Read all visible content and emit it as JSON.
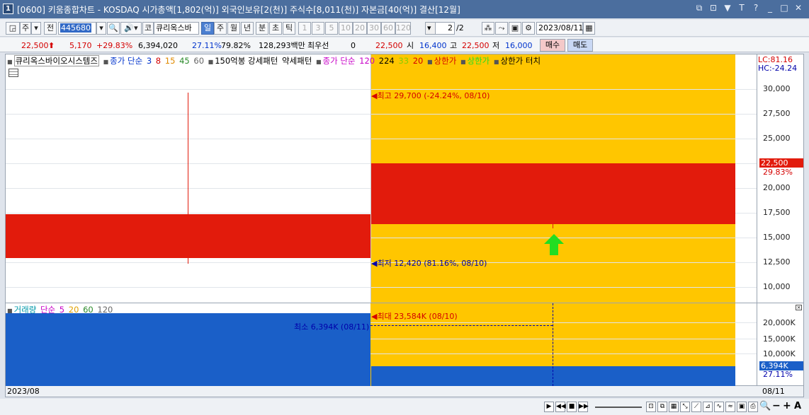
{
  "window": {
    "number": "1",
    "title": "[0600] 키움종합차트 - KOSDAQ 시가총액[1,802(억)] 외국인보유[2(천)] 주식수[8,011(천)] 자본금[40(억)] 결산[12월]",
    "controls": [
      "⧉",
      "⊡",
      "▼",
      "T",
      "?",
      "_",
      "□",
      "✕"
    ]
  },
  "toolbar": {
    "period_type": "주",
    "whole": "전",
    "code": "445680",
    "market": "코",
    "stock_name": "큐리옥스바",
    "tabs": [
      "일",
      "주",
      "월",
      "년",
      "분",
      "초",
      "틱"
    ],
    "selected_tab": "일",
    "numbers": [
      "1",
      "3",
      "5",
      "10",
      "20",
      "30",
      "60",
      "120"
    ],
    "page": "2",
    "page_total": "/2",
    "date": "2023/08/11"
  },
  "quote": {
    "price": "22,500",
    "change": "5,170",
    "change_pct": "+29.83%",
    "volume": "6,394,020",
    "ratio1": "27.11%",
    "ratio2": "79.82%",
    "amount": "128,293백만",
    "pref_label": "최우선",
    "pref_value": "0",
    "close": "22,500",
    "open_label": "시",
    "open": "16,400",
    "high_label": "고",
    "high": "22,500",
    "low_label": "저",
    "low": "16,000",
    "buy": "매수",
    "sell": "매도"
  },
  "price_panel": {
    "legend": {
      "name": "큐리옥스바이오시스템즈",
      "ma_label": "종가 단순",
      "ma_values": [
        "3",
        "8",
        "15",
        "45",
        "60"
      ],
      "ind1": "150억봉 강세패턴",
      "ind2": "약세패턴",
      "ma2_label": "종가 단순",
      "ma2_values": [
        "120",
        "224",
        "33",
        "20"
      ],
      "limit_up": "상한가",
      "limit_up2": "상한가",
      "limit_touch": "상한가 터치"
    },
    "lc": "LC:81.16",
    "hc": "HC:-24.24",
    "high_annotation": "최고 29,700 (-24.24%, 08/10)",
    "low_annotation": "최저 12,420 (81.16%, 08/10)",
    "axis_ticks": [
      "30,000",
      "27,500",
      "25,000",
      "20,000",
      "17,500",
      "15,000",
      "12,500",
      "10,000"
    ],
    "price_tag": "22,500",
    "price_tag_pct": "29.83%"
  },
  "volume_panel": {
    "legend": {
      "name": "거래량",
      "ma_label": "단순",
      "ma_values": [
        "5",
        "20",
        "60",
        "120"
      ]
    },
    "max_annotation": "최대 23,584K (08/10)",
    "min_annotation": "최소 6,394K (08/11)",
    "axis_ticks": [
      "20,000K",
      "15,000K",
      "10,000K"
    ],
    "vol_tag": "6,394K",
    "vol_tag_pct": "27.11%"
  },
  "footer": {
    "left_date": "2023/08",
    "right_date": "08/11"
  },
  "chart_data": {
    "type": "candlestick",
    "candles": [
      {
        "date": "08/10",
        "open": 17400,
        "high": 29700,
        "low": 12420,
        "close": 13000,
        "volume": 23584
      },
      {
        "date": "08/11",
        "open": 16400,
        "high": 22500,
        "low": 16000,
        "close": 22500,
        "volume": 6394
      }
    ],
    "price_ylim": [
      8000,
      31000
    ],
    "volume_unit": "K",
    "colors": {
      "up": "#e21b0c",
      "down": "#e21b0c",
      "volume": "#1a5fc8",
      "limit_up_bg": "#ffc600",
      "signal": "#22dd22"
    }
  }
}
